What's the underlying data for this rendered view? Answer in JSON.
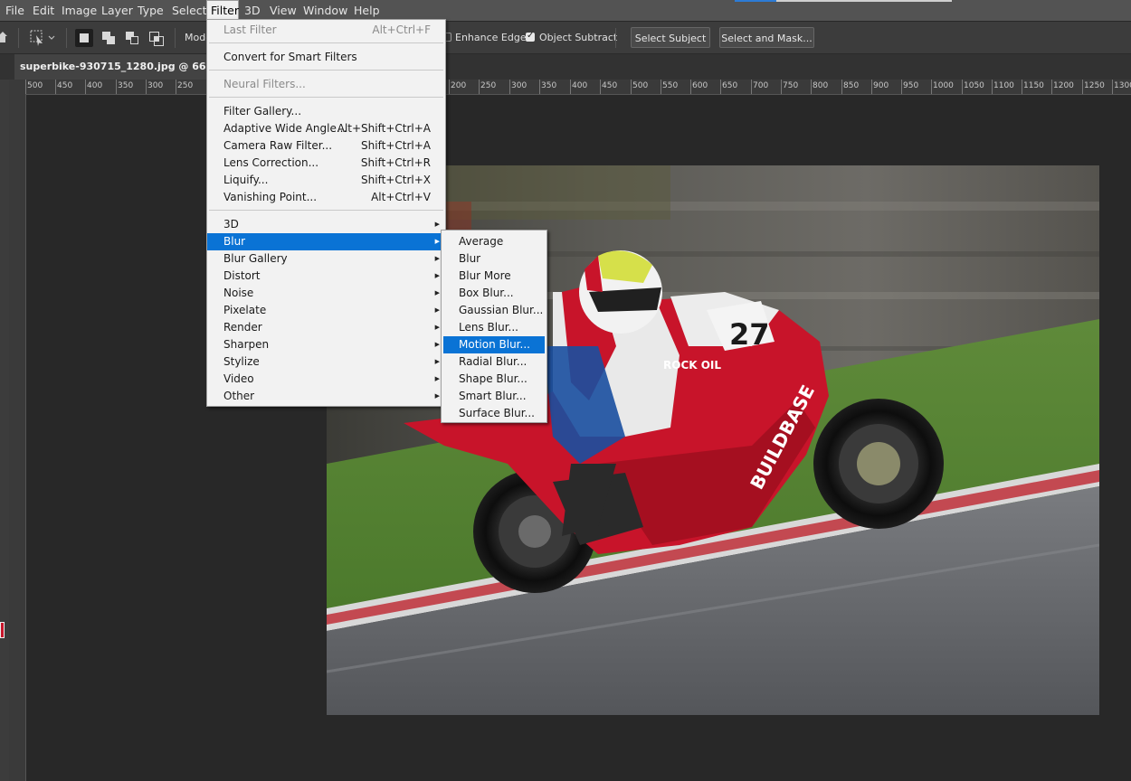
{
  "menubar": {
    "items": [
      "File",
      "Edit",
      "Image",
      "Layer",
      "Type",
      "Select",
      "Filter",
      "3D",
      "View",
      "Window",
      "Help"
    ]
  },
  "options": {
    "mode_label": "Mode",
    "enhance_edge": "Enhance Edge",
    "object_subtract": "Object Subtract",
    "select_subject": "Select Subject",
    "select_and_mask": "Select and Mask..."
  },
  "document": {
    "tab_title": "superbike-930715_1280.jpg @ 66.7% (B"
  },
  "ruler": {
    "h_labels": [
      "500",
      "450",
      "400",
      "350",
      "300",
      "250",
      "200",
      "250",
      "300",
      "350",
      "400",
      "450",
      "500",
      "550",
      "600",
      "650",
      "700",
      "750",
      "800",
      "850",
      "900",
      "950",
      "1000",
      "1050",
      "1100",
      "1150",
      "1200",
      "1250",
      "1300"
    ]
  },
  "filter_menu": {
    "items": [
      {
        "label": "Last Filter",
        "shortcut": "Alt+Ctrl+F",
        "disabled": true
      },
      {
        "label": "Convert for Smart Filters",
        "shortcut": ""
      },
      {
        "label": "Neural Filters...",
        "shortcut": "",
        "disabled": true
      },
      {
        "label": "Filter Gallery...",
        "shortcut": ""
      },
      {
        "label": "Adaptive Wide Angle...",
        "shortcut": "Alt+Shift+Ctrl+A"
      },
      {
        "label": "Camera Raw Filter...",
        "shortcut": "Shift+Ctrl+A"
      },
      {
        "label": "Lens Correction...",
        "shortcut": "Shift+Ctrl+R"
      },
      {
        "label": "Liquify...",
        "shortcut": "Shift+Ctrl+X"
      },
      {
        "label": "Vanishing Point...",
        "shortcut": "Alt+Ctrl+V"
      },
      {
        "label": "3D",
        "submenu": true
      },
      {
        "label": "Blur",
        "submenu": true,
        "highlighted": true
      },
      {
        "label": "Blur Gallery",
        "submenu": true
      },
      {
        "label": "Distort",
        "submenu": true
      },
      {
        "label": "Noise",
        "submenu": true
      },
      {
        "label": "Pixelate",
        "submenu": true
      },
      {
        "label": "Render",
        "submenu": true
      },
      {
        "label": "Sharpen",
        "submenu": true
      },
      {
        "label": "Stylize",
        "submenu": true
      },
      {
        "label": "Video",
        "submenu": true
      },
      {
        "label": "Other",
        "submenu": true
      }
    ]
  },
  "blur_submenu": {
    "items": [
      {
        "label": "Average"
      },
      {
        "label": "Blur"
      },
      {
        "label": "Blur More"
      },
      {
        "label": "Box Blur..."
      },
      {
        "label": "Gaussian Blur..."
      },
      {
        "label": "Lens Blur..."
      },
      {
        "label": "Motion Blur...",
        "highlighted": true
      },
      {
        "label": "Radial Blur..."
      },
      {
        "label": "Shape Blur..."
      },
      {
        "label": "Smart Blur..."
      },
      {
        "label": "Surface Blur..."
      }
    ]
  },
  "photo_text": {
    "rock_oil": "ROCK OIL",
    "buildbase": "BUILDBASE",
    "number": "27"
  },
  "colors": {
    "highlight": "#0a73d5",
    "menu_bg": "#f2f2f2",
    "app_bg": "#282828",
    "bike_red": "#c8142a"
  }
}
